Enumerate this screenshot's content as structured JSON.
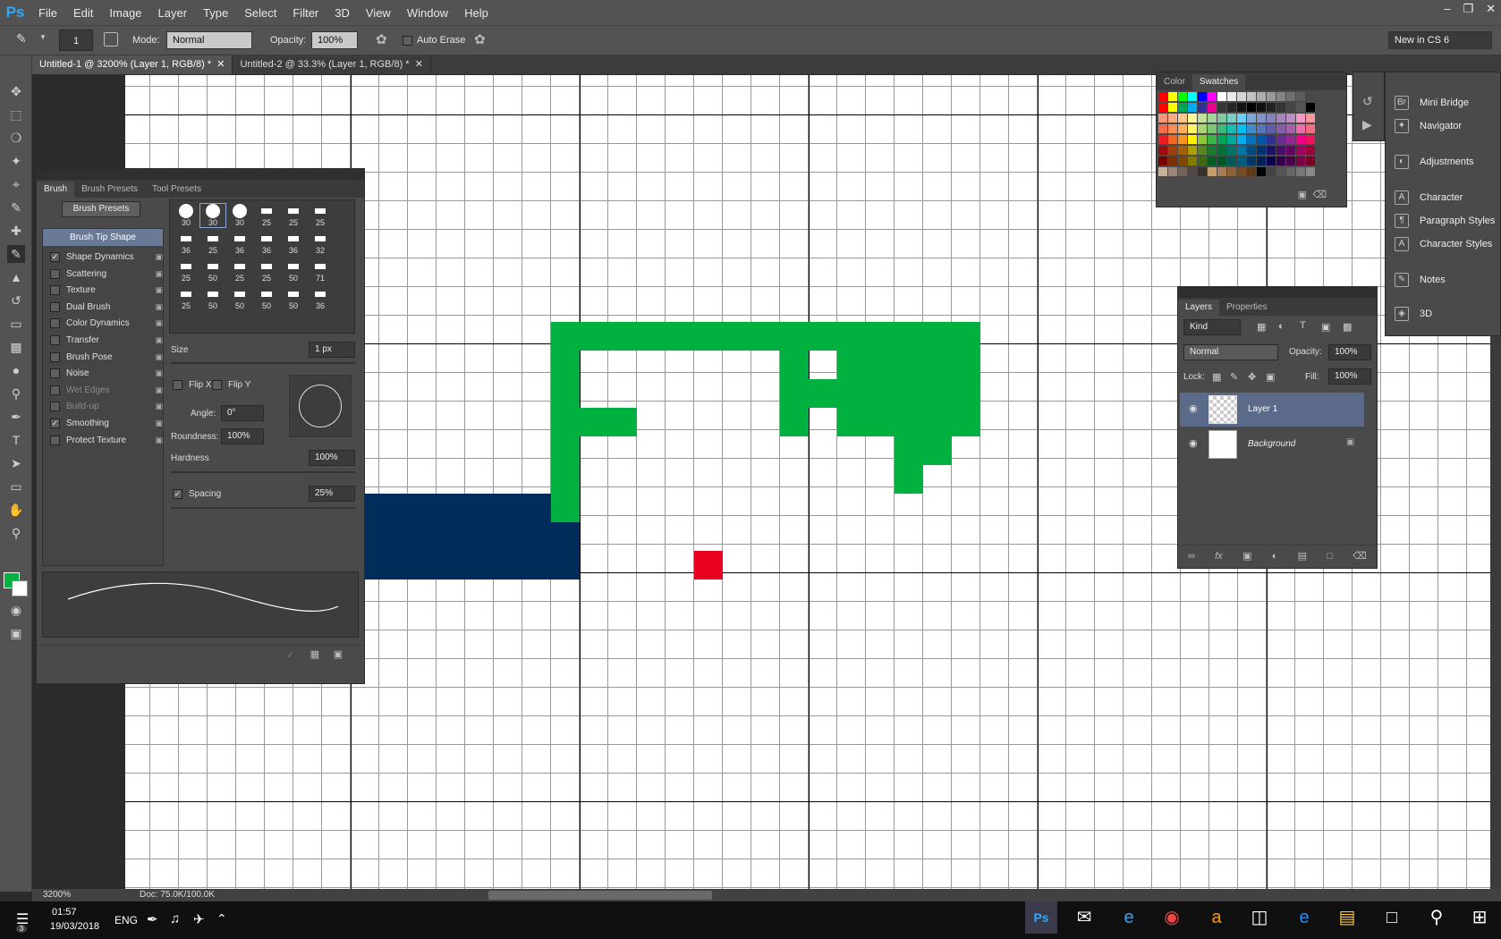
{
  "app": {
    "logo": "Ps"
  },
  "menu": [
    "File",
    "Edit",
    "Image",
    "Layer",
    "Type",
    "Select",
    "Filter",
    "3D",
    "View",
    "Window",
    "Help"
  ],
  "options": {
    "brush_size": "1",
    "mode_label": "Mode:",
    "mode_value": "Normal",
    "opacity_label": "Opacity:",
    "opacity_value": "100%",
    "auto_erase": "Auto Erase",
    "workspace": "New in CS 6"
  },
  "tabs": [
    "Untitled-1 @ 3200% (Layer 1, RGB/8) *",
    "Untitled-2 @ 33.3% (Layer 1, RGB/8) *"
  ],
  "brush_panel": {
    "tabs": [
      "Brush",
      "Brush Presets",
      "Tool Presets"
    ],
    "presets_button": "Brush Presets",
    "tip_shape": "Brush Tip Shape",
    "options": [
      {
        "label": "Shape Dynamics",
        "checked": true
      },
      {
        "label": "Scattering",
        "checked": false
      },
      {
        "label": "Texture",
        "checked": false
      },
      {
        "label": "Dual Brush",
        "checked": false
      },
      {
        "label": "Color Dynamics",
        "checked": false
      },
      {
        "label": "Transfer",
        "checked": false
      },
      {
        "label": "Brush Pose",
        "checked": false
      },
      {
        "label": "Noise",
        "checked": false
      },
      {
        "label": "Wet Edges",
        "checked": false
      },
      {
        "label": "Build-up",
        "checked": false
      },
      {
        "label": "Smoothing",
        "checked": true
      },
      {
        "label": "Protect Texture",
        "checked": false
      }
    ],
    "tip_sizes": [
      [
        "30",
        "30",
        "30",
        "25",
        "25",
        "25"
      ],
      [
        "36",
        "25",
        "36",
        "36",
        "36",
        "32"
      ],
      [
        "25",
        "50",
        "25",
        "25",
        "50",
        "71"
      ],
      [
        "25",
        "50",
        "50",
        "50",
        "50",
        "36"
      ]
    ],
    "size_label": "Size",
    "size_value": "1 px",
    "flipx": "Flip X",
    "flipy": "Flip Y",
    "angle_label": "Angle:",
    "angle_value": "0°",
    "roundness_label": "Roundness:",
    "roundness_value": "100%",
    "hardness_label": "Hardness",
    "hardness_value": "100%",
    "spacing_label": "Spacing",
    "spacing_value": "25%"
  },
  "swatch_panel": {
    "tabs": [
      "Color",
      "Swatches"
    ]
  },
  "right_panel": [
    "Mini Bridge",
    "Navigator",
    "Adjustments",
    "Character",
    "Paragraph Styles",
    "Character Styles",
    "Notes",
    "3D"
  ],
  "layers_panel": {
    "tabs": [
      "Layers",
      "Properties"
    ],
    "kind": "Kind",
    "blend": "Normal",
    "opacity_label": "Opacity:",
    "opacity_value": "100%",
    "lock_label": "Lock:",
    "fill_label": "Fill:",
    "fill_value": "100%",
    "layers": [
      "Layer 1",
      "Background"
    ]
  },
  "status": {
    "zoom": "3200%",
    "doc": "Doc: 75.0K/100.0K"
  },
  "taskbar": {
    "time": "01:57",
    "date": "19/03/2018",
    "lang": "ENG",
    "notif": "3"
  },
  "colors": {
    "green": "#00b140",
    "navy": "#002d5a",
    "red": "#e8001e",
    "fg": "#00b140",
    "bg": "#ffffff"
  }
}
